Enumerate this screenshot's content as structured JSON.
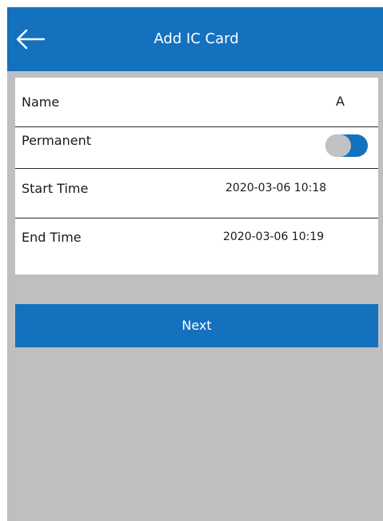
{
  "header": {
    "title": "Add IC Card",
    "back_icon": "arrow-left-icon"
  },
  "form": {
    "name": {
      "label": "Name",
      "value": "A"
    },
    "permanent": {
      "label": "Permanent",
      "toggle_on": true
    },
    "start_time": {
      "label": "Start Time",
      "value": "2020-03-06 10:18"
    },
    "end_time": {
      "label": "End Time",
      "value": "2020-03-06 10:19"
    }
  },
  "actions": {
    "next_label": "Next"
  },
  "colors": {
    "primary": "#1471be",
    "screen_background": "#bfbfc2",
    "card_background": "#ffffff",
    "toggle_knob": "#c2c2c5"
  }
}
